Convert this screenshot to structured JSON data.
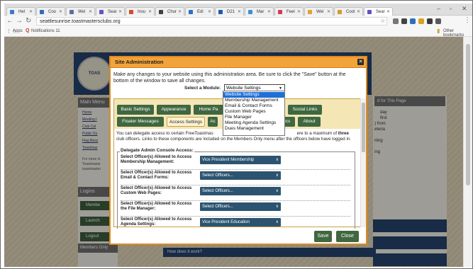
{
  "browser": {
    "tabs": [
      {
        "label": "Hel",
        "color": "#3c7cc2"
      },
      {
        "label": "Coo",
        "color": "#2e6db4"
      },
      {
        "label": "Wel",
        "color": "#5a6f9c"
      },
      {
        "label": "Sear",
        "color": "#6a4fbf"
      },
      {
        "label": "Insu",
        "color": "#d34b2a"
      },
      {
        "label": "Chur",
        "color": "#3f3f3f"
      },
      {
        "label": "Edi",
        "color": "#2d6fc2"
      },
      {
        "label": "D21",
        "color": "#1e5aa8"
      },
      {
        "label": "Mar",
        "color": "#3f8ed1"
      },
      {
        "label": "Feel",
        "color": "#d63b4c"
      },
      {
        "label": "Wel",
        "color": "#e2a230"
      },
      {
        "label": "Cool",
        "color": "#d19c2a"
      },
      {
        "label": "Sear",
        "color": "#6a4fbf"
      }
    ],
    "url": "seattlesunrise.toastmastersclubs.org",
    "bookmarks": {
      "apps": "Apps",
      "notif": "Notifications 11",
      "other": "Other bookmarks"
    }
  },
  "site": {
    "logo_text": "TOAS",
    "left_head": "Main Menu",
    "left_links": [
      "Home",
      "Meeting I",
      "Club Cal",
      "Public Do",
      "Flag Bess",
      "Toastmas"
    ],
    "left_note": [
      "For more in",
      "Toastmaste",
      "toastmaster"
    ],
    "logins_head": "Logins",
    "logins_buttons": [
      "Membe",
      "Launch",
      "Logout"
    ],
    "members_only": "Members Only",
    "right_head": "d for This Page",
    "right_text": [
      "day",
      "first",
      ") from",
      "eteria",
      "",
      "rting",
      "",
      "ing"
    ],
    "bottom_link": "How does it work?"
  },
  "modal": {
    "title": "Site Administration",
    "intro": "Make any changes to your website using this administration area. Be sure to click the \"Save\" button at the bottom of the window to save all changes.",
    "module_label": "Select a Module:",
    "module_value": "Website Settings",
    "tabs_row1": [
      "Basic Settings",
      "Appearance",
      "Home Pa",
      "",
      "Social Links"
    ],
    "tabs_row2": [
      "Floater Messages",
      "Access Settings",
      "Ac",
      "",
      "istics",
      "About"
    ],
    "desc_a": "You can delegate access to certain FreeToastmas",
    "desc_b": "ere to a maximum of ",
    "desc_bold": "three",
    "desc_c": "club officers. Links to these components are included on the Members Only menu after the officers below have logged in.",
    "legend": "Delegate Admin Console Access:",
    "rows": [
      {
        "label": "Select Officer(s) Allowed to Access Membership Management:",
        "value": "Vice President Membership"
      },
      {
        "label": "Select Officer(s) Allowed to Access Email & Contact Forms:",
        "value": "Select Officers..."
      },
      {
        "label": "Select Officer(s) Allowed to Access Custom Web Pages:",
        "value": "Select Officers..."
      },
      {
        "label": "Select Officer(s) Allowed to Access the File Manager:",
        "value": "Select Officers..."
      },
      {
        "label": "Select Officer(s) Allowed to Access Agenda Settings:",
        "value": "Vice President Education"
      }
    ],
    "save": "Save",
    "close": "Close"
  },
  "dropdown_options": [
    "Website Settings",
    "Membership Management",
    "Email & Contact Forms",
    "Custom Web Pages",
    "File Manager",
    "Meeting Agenda Settings",
    "Dues Management"
  ],
  "colors": {
    "modal_accent": "#f2a33a",
    "tab_green": "#3f6740",
    "select_blue": "#2c5470",
    "highlight": "#1e6fd8"
  }
}
